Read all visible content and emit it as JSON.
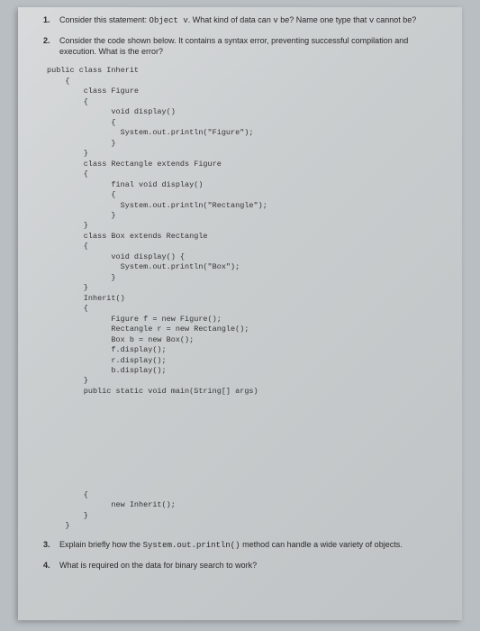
{
  "questions": {
    "q1": {
      "num": "1.",
      "text_a": "Consider this statement: ",
      "code_a": "Object v",
      "text_b": ". What kind of data can ",
      "code_b": "v",
      "text_c": " be? Name one type that ",
      "code_c": "v",
      "text_d": " cannot be?"
    },
    "q2": {
      "num": "2.",
      "text": "Consider the code shown below.  It contains a syntax error, preventing successful compilation and execution.  What is the error?"
    },
    "q3": {
      "num": "3.",
      "text_a": "Explain briefly how the ",
      "code_a": "System.out.println()",
      "text_b": " method can handle a wide variety of objects."
    },
    "q4": {
      "num": "4.",
      "text": "What is required on the data for binary search to work?"
    }
  },
  "code": {
    "l01": "public class Inherit",
    "l02": "    {",
    "l03": "        class Figure",
    "l04": "        {",
    "l05": "              void display()",
    "l06": "              {",
    "l07": "                System.out.println(\"Figure\");",
    "l08": "              }",
    "l09": "        }",
    "l10": "        class Rectangle extends Figure",
    "l11": "        {",
    "l12": "              final void display()",
    "l13": "              {",
    "l14": "                System.out.println(\"Rectangle\");",
    "l15": "              }",
    "l16": "        }",
    "l17": "        class Box extends Rectangle",
    "l18": "        {",
    "l19": "              void display() {",
    "l20": "                System.out.println(\"Box\");",
    "l21": "              }",
    "l22": "        }",
    "l23": "        Inherit()",
    "l24": "        {",
    "l25": "              Figure f = new Figure();",
    "l26": "              Rectangle r = new Rectangle();",
    "l27": "              Box b = new Box();",
    "l28": "              f.display();",
    "l29": "              r.display();",
    "l30": "              b.display();",
    "l31": "        }",
    "l32": "        public static void main(String[] args)",
    "gap": "",
    "l33": "        {",
    "l34": "              new Inherit();",
    "l35": "        }",
    "l36": "    }"
  }
}
